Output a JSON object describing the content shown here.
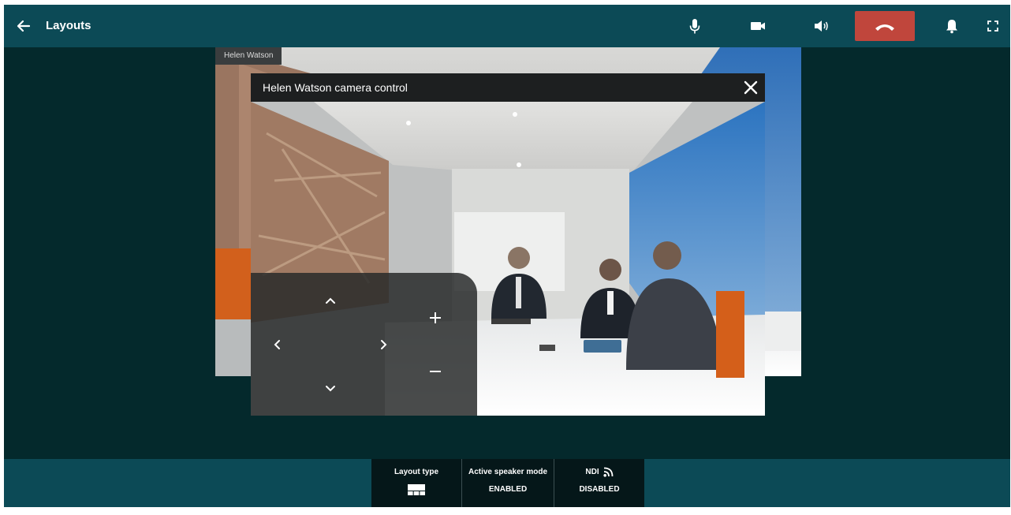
{
  "header": {
    "title": "Layouts",
    "icons": [
      "arrow-left-icon",
      "microphone-icon",
      "video-camera-icon",
      "speaker-icon",
      "phone-hangup-icon",
      "bell-icon",
      "fullscreen-icon"
    ],
    "hangup_color": "#c0463c",
    "bar_color": "#0c4a56"
  },
  "video": {
    "participant_name": "Helen Watson"
  },
  "camera_control": {
    "title": "Helen Watson camera control",
    "icons": [
      "close-icon",
      "chevron-up-icon",
      "chevron-down-icon",
      "chevron-left-icon",
      "chevron-right-icon",
      "zoom-in-icon",
      "zoom-out-icon"
    ]
  },
  "bottom_bar": {
    "layout_type_label": "Layout type",
    "layout_icon": "layout-grid-icon",
    "active_speaker_label": "Active speaker mode",
    "active_speaker_value": "ENABLED",
    "ndi_label": "NDI",
    "ndi_icon": "rss-feed-icon",
    "ndi_value": "DISABLED"
  }
}
